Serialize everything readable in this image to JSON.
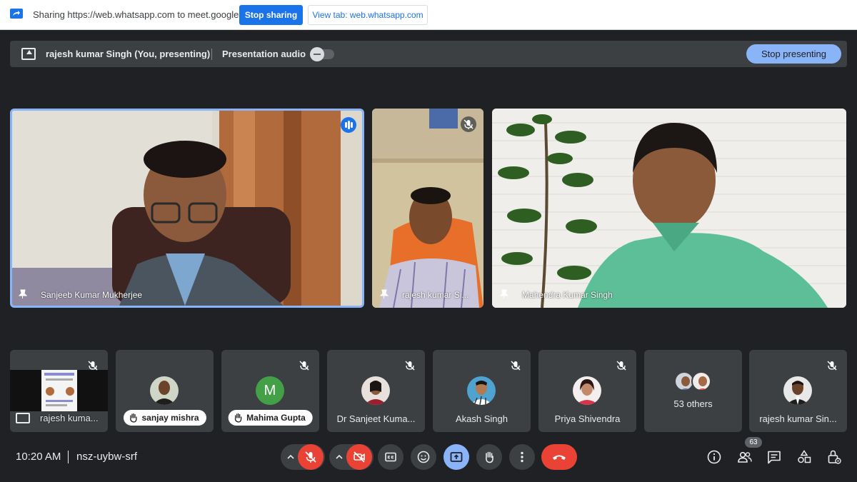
{
  "share_bar": {
    "message": "Sharing https://web.whatsapp.com to meet.google.com",
    "stop_sharing_label": "Stop sharing",
    "view_tab_label": "View tab: web.whatsapp.com"
  },
  "presenting_bar": {
    "presenter": "rajesh kumar Singh (You, presenting)",
    "audio_label": "Presentation audio",
    "audio_enabled": false,
    "stop_presenting_label": "Stop presenting"
  },
  "main_tiles": [
    {
      "name": "Sanjeeb Kumar Mukherjee",
      "speaking": true
    },
    {
      "name": "rajesh kumar Si...",
      "muted": true
    },
    {
      "name": "Mahendra Kumar Singh"
    }
  ],
  "thumbnails": [
    {
      "name": "rajesh kuma...",
      "presentation": true,
      "muted": true
    },
    {
      "name": "sanjay mishra",
      "pill": true
    },
    {
      "name": "Mahima Gupta",
      "pill": true,
      "initial": "M",
      "avatar_color": "#43a047",
      "muted": true
    },
    {
      "name": "Dr Sanjeet Kuma...",
      "muted": true
    },
    {
      "name": "Akash Singh",
      "muted": true
    },
    {
      "name": "Priya Shivendra",
      "muted": true
    },
    {
      "name": "53 others"
    },
    {
      "name": "rajesh kumar Sin...",
      "muted": true
    }
  ],
  "footer": {
    "time": "10:20 AM",
    "meeting_code": "nsz-uybw-srf",
    "participant_count": "63"
  },
  "colors": {
    "accent": "#1a73e8",
    "danger": "#ea4335",
    "background": "#202124",
    "tile": "#3c4043",
    "highlight": "#8ab4f8"
  }
}
